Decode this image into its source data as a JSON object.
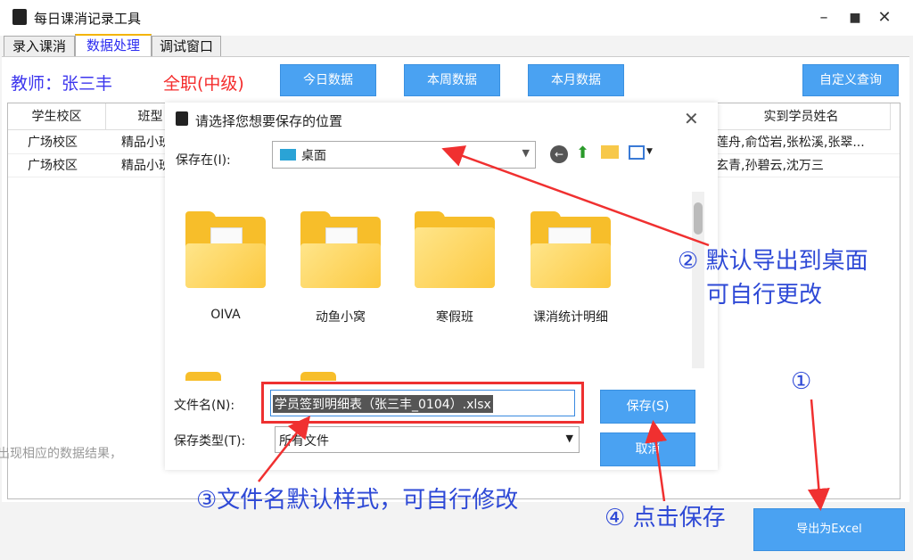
{
  "window": {
    "title": "每日课消记录工具",
    "minimize": "–",
    "maximize": "■",
    "close": "✕"
  },
  "tabs": [
    {
      "label": "录入课消"
    },
    {
      "label": "数据处理",
      "active": true
    },
    {
      "label": "调试窗口"
    }
  ],
  "toolbar": {
    "teacher": "教师：张三丰",
    "level": "全职(中级)",
    "today": "今日数据",
    "week": "本周数据",
    "month": "本月数据",
    "custom": "自定义查询"
  },
  "grid": {
    "headers": [
      "学生校区",
      "班型",
      "实到学员姓名"
    ],
    "rows": [
      [
        "广场校区",
        "精品小班",
        "宋莲舟,俞岱岩,张松溪,张翠..."
      ],
      [
        "广场校区",
        "精品小班",
        "丘玄青,孙碧云,沈万三"
      ]
    ],
    "hint": "出现相应的数据结果，"
  },
  "dialog": {
    "title": "请选择您想要保存的位置",
    "save_in_label": "保存在(I):",
    "save_in_value": "桌面",
    "folders": [
      {
        "name": "OIVA"
      },
      {
        "name": "动鱼小窝"
      },
      {
        "name": "寒假班"
      },
      {
        "name": "课消统计明细"
      }
    ],
    "filename_label": "文件名(N):",
    "filename_value": "学员签到明细表（张三丰_0104）.xlsx",
    "filetype_label": "保存类型(T):",
    "filetype_value": "所有文件",
    "save_button": "保存(S)",
    "cancel_button": "取消",
    "close": "✕"
  },
  "export_button": "导出为Excel",
  "annotations": {
    "a1": "①",
    "a2_line1": "② 默认导出到桌面",
    "a2_line2": "可自行更改",
    "a3": "③文件名默认样式，可自行修改",
    "a4": "④ 点击保存"
  },
  "colors": {
    "accent": "#4aa2f2",
    "teacher": "#3d36ee",
    "level": "#f42c2c",
    "annotation": "#2e49d6",
    "arrow": "#f03030"
  }
}
